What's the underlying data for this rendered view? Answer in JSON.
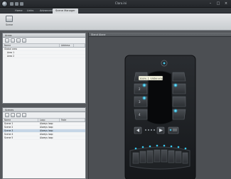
{
  "window": {
    "title": "Claro.ini"
  },
  "menu": {
    "tabs": [
      "Home",
      "Links",
      "Advanced",
      "Scene Manager"
    ],
    "active_index": 3
  },
  "ribbon": {
    "button_label": "Scene"
  },
  "areas": {
    "title": "Areas",
    "columns": [
      "Name",
      "Address",
      ""
    ],
    "rows": [
      {
        "name": "Global area",
        "address": ""
      },
      {
        "name": "Area 1",
        "address": ""
      },
      {
        "name": "Area 2",
        "address": ""
      }
    ]
  },
  "scenes": {
    "title": "Scenes",
    "columns": [
      "Name",
      "Loop",
      "Fade"
    ],
    "rows": [
      {
        "name": "Scene 1",
        "loop": "Always loop",
        "fade": ""
      },
      {
        "name": "Scene 2",
        "loop": "Always loop",
        "fade": ""
      },
      {
        "name": "Scene 3",
        "loop": "Always loop",
        "fade": ""
      },
      {
        "name": "Scene 4",
        "loop": "Always loop",
        "fade": ""
      },
      {
        "name": "Scene 5",
        "loop": "Always loop",
        "fade": ""
      }
    ],
    "selected_index": 2
  },
  "device_panel": {
    "title": "Stand Alone",
    "tooltip": "Scene 1: Global area"
  },
  "colors": {
    "accent": "#38c9f0",
    "panel_bg": "#f4f5f6",
    "device_bg": "#1e2023"
  }
}
